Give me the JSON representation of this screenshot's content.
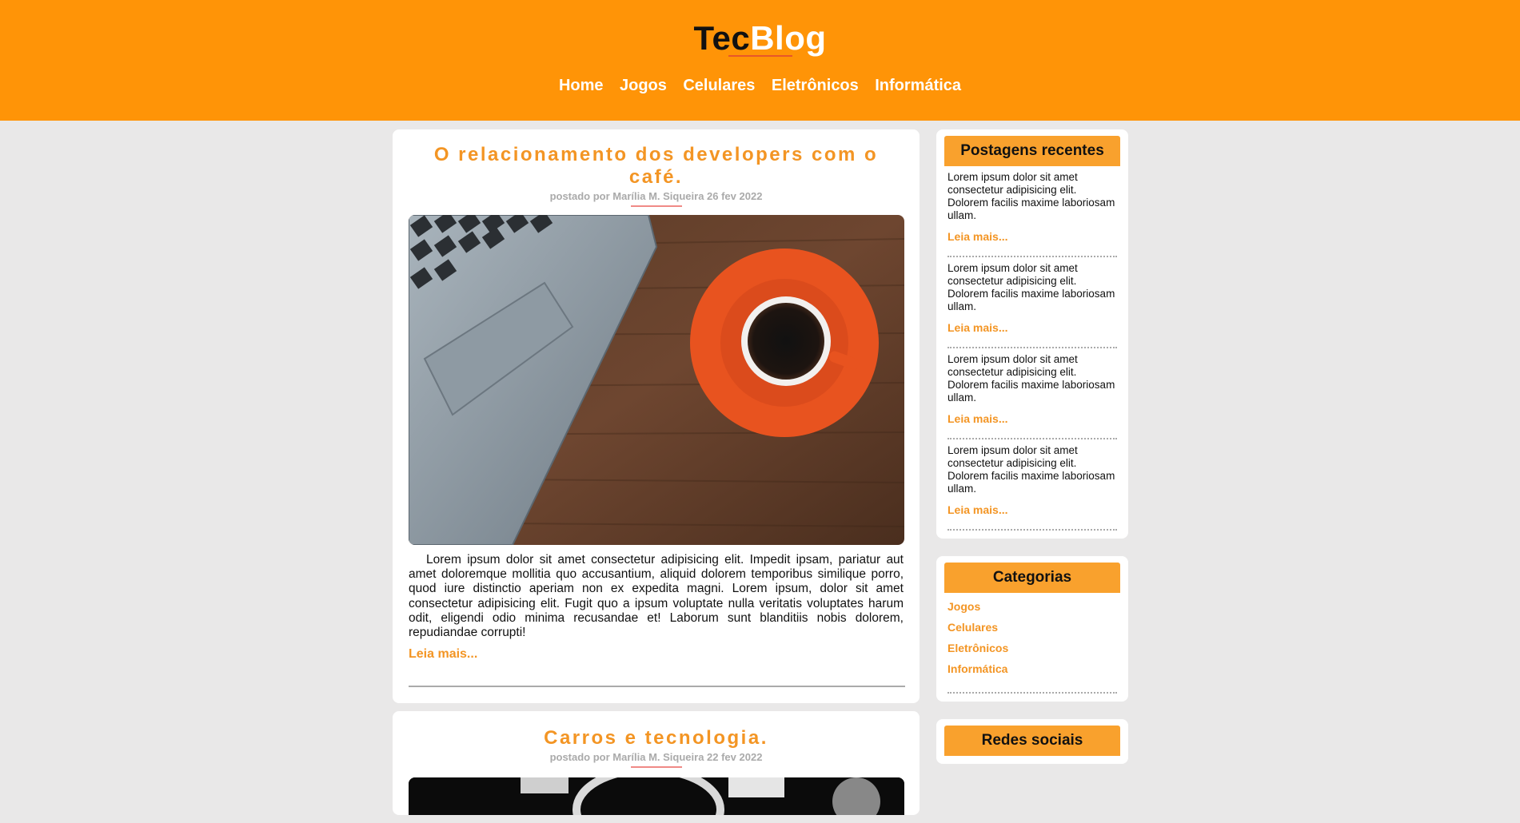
{
  "header": {
    "logo_part1": "Tec",
    "logo_part2": "Blog",
    "nav": [
      "Home",
      "Jogos",
      "Celulares",
      "Eletrônicos",
      "Informática"
    ]
  },
  "posts": [
    {
      "title": "O relacionamento dos developers com o café.",
      "meta": "postado por Marília M. Siqueira 26 fev 2022",
      "text": "Lorem ipsum dolor sit amet consectetur adipisicing elit. Impedit ipsam, pariatur aut amet doloremque mollitia quo accusantium, aliquid dolorem temporibus similique porro, quod iure distinctio aperiam non ex expedita magni. Lorem ipsum, dolor sit amet consectetur adipisicing elit. Fugit quo a ipsum voluptate nulla veritatis voluptates harum odit, eligendi odio minima recusandae et! Laborum sunt blanditiis nobis dolorem, repudiandae corrupti!",
      "read_more": "Leia mais..."
    },
    {
      "title": "Carros e tecnologia.",
      "meta": "postado por Marília M. Siqueira 22 fev 2022"
    }
  ],
  "sidebar": {
    "recent_title": "Postagens recentes",
    "recent": [
      {
        "text": "Lorem ipsum dolor sit amet consectetur adipisicing elit. Dolorem facilis maxime laboriosam ullam.",
        "link": "Leia mais..."
      },
      {
        "text": "Lorem ipsum dolor sit amet consectetur adipisicing elit. Dolorem facilis maxime laboriosam ullam.",
        "link": "Leia mais..."
      },
      {
        "text": "Lorem ipsum dolor sit amet consectetur adipisicing elit. Dolorem facilis maxime laboriosam ullam.",
        "link": "Leia mais..."
      },
      {
        "text": "Lorem ipsum dolor sit amet consectetur adipisicing elit. Dolorem facilis maxime laboriosam ullam.",
        "link": "Leia mais..."
      }
    ],
    "categories_title": "Categorias",
    "categories": [
      "Jogos",
      "Celulares",
      "Eletrônicos",
      "Informática"
    ],
    "social_title": "Redes sociais"
  },
  "colors": {
    "header_bg": "#ff9407",
    "accent": "#f39524",
    "widget_title_bg": "#f9a12d",
    "page_bg": "#e9e8e8"
  }
}
